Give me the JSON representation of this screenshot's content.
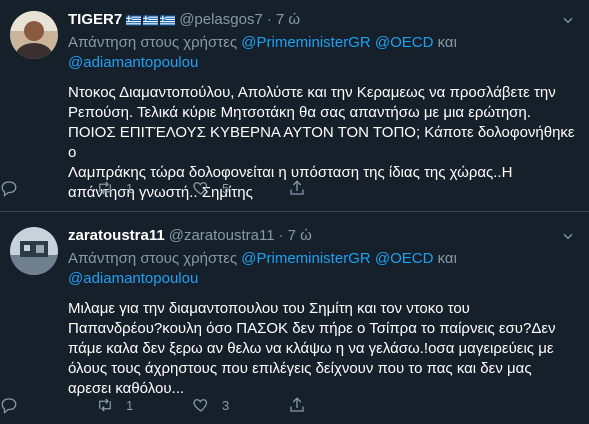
{
  "tweets": [
    {
      "display_name": "TIGER7",
      "handle": "@pelasgos7",
      "separator": "·",
      "time": "7 ώ",
      "reply_label": "Απάντηση στους χρήστες",
      "mentions": [
        "@PrimeministerGR",
        "@OECD"
      ],
      "conjunction": "και",
      "last_mention": "@adiamantopoulou",
      "text": "Ντοκος Διαμαντοπούλου, Απολύστε και την Κεραμεως να προσλάβετε την\nΡεπούση. Τελικά κύριε Μητσοτάκη θα σας απαντήσω με μια ερώτηση.\nΠΟΙΟΣ ΕΠΙΤΈΛΟΥΣ ΚΥΒΕΡΝΑ ΑΥΤΟΝ ΤΟΝ ΤΟΠΟ; Κάποτε δολοφονήθηκε ο\nΛαμπράκης τώρα δολοφονείται η υπόσταση της ίδιας της χώρας..Η\nαπάντηση γνωστή.. Σημίτης",
      "reply_count": "",
      "retweet_count": "1",
      "like_count": "5"
    },
    {
      "display_name": "zaratoustra11",
      "handle": "@zaratoustra11",
      "separator": "·",
      "time": "7 ώ",
      "reply_label": "Απάντηση στους χρήστες",
      "mentions": [
        "@PrimeministerGR",
        "@OECD"
      ],
      "conjunction": "και",
      "last_mention": "@adiamantopoulou",
      "text": "Μιλαμε για την διαμαντοπουλου του Σημίτη και τον ντοκο του\nΠαπανδρέου?κουλη όσο ΠΑΣΟΚ δεν πήρε ο Τσίπρα το παίρνεις εσυ?Δεν\nπάμε καλα δεν ξερω αν θελω να κλάψω η να γελάσω.!οσα μαγειρεύεις με\nόλους τους άχρηστους που επιλέγεις δείχνουν που το πας και δεν μας\nαρεσει καθόλου...",
      "reply_count": "",
      "retweet_count": "1",
      "like_count": "3"
    }
  ],
  "icons": {
    "more": "chevron-down-icon",
    "reply": "reply-icon",
    "retweet": "retweet-icon",
    "like": "heart-icon",
    "share": "share-icon",
    "flag": "greek-flag-icon"
  },
  "colors": {
    "background": "#15202b",
    "secondary_text": "#8899a6",
    "link": "#1da1f2",
    "divider": "#38444d"
  }
}
